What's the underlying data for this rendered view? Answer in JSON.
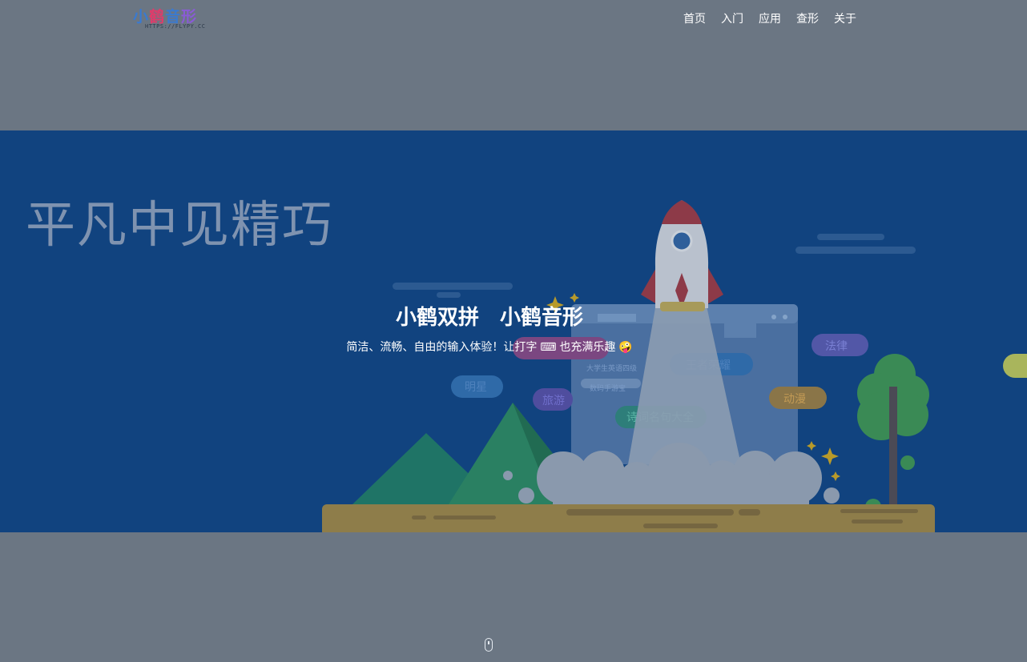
{
  "header": {
    "logo_text": "小鹤音形",
    "logo_url": "HTTPS://FLYPY.CC",
    "nav": [
      "首页",
      "入门",
      "应用",
      "查形",
      "关于"
    ]
  },
  "hero": {
    "slogan": "平凡中见精巧",
    "title": "小鹤双拼　小鹤音形",
    "subtitle": "简洁、流畅、自由的输入体验！让打字 ⌨ 也充满乐趣 🤪",
    "tags": [
      "法律",
      "王者荣耀",
      "明星",
      "旅游",
      "动漫",
      "诗词名句大全",
      "人工智能"
    ],
    "search_lines": [
      "大学生英语四级",
      "数码手游宝"
    ]
  },
  "colors": {
    "page_overlay": "#6b7683",
    "hero_bg": "#11437f",
    "side_dot": "#a9b55c"
  },
  "icons": {
    "scroll": "mouse-scroll-icon",
    "side": "side-circle-icon"
  }
}
